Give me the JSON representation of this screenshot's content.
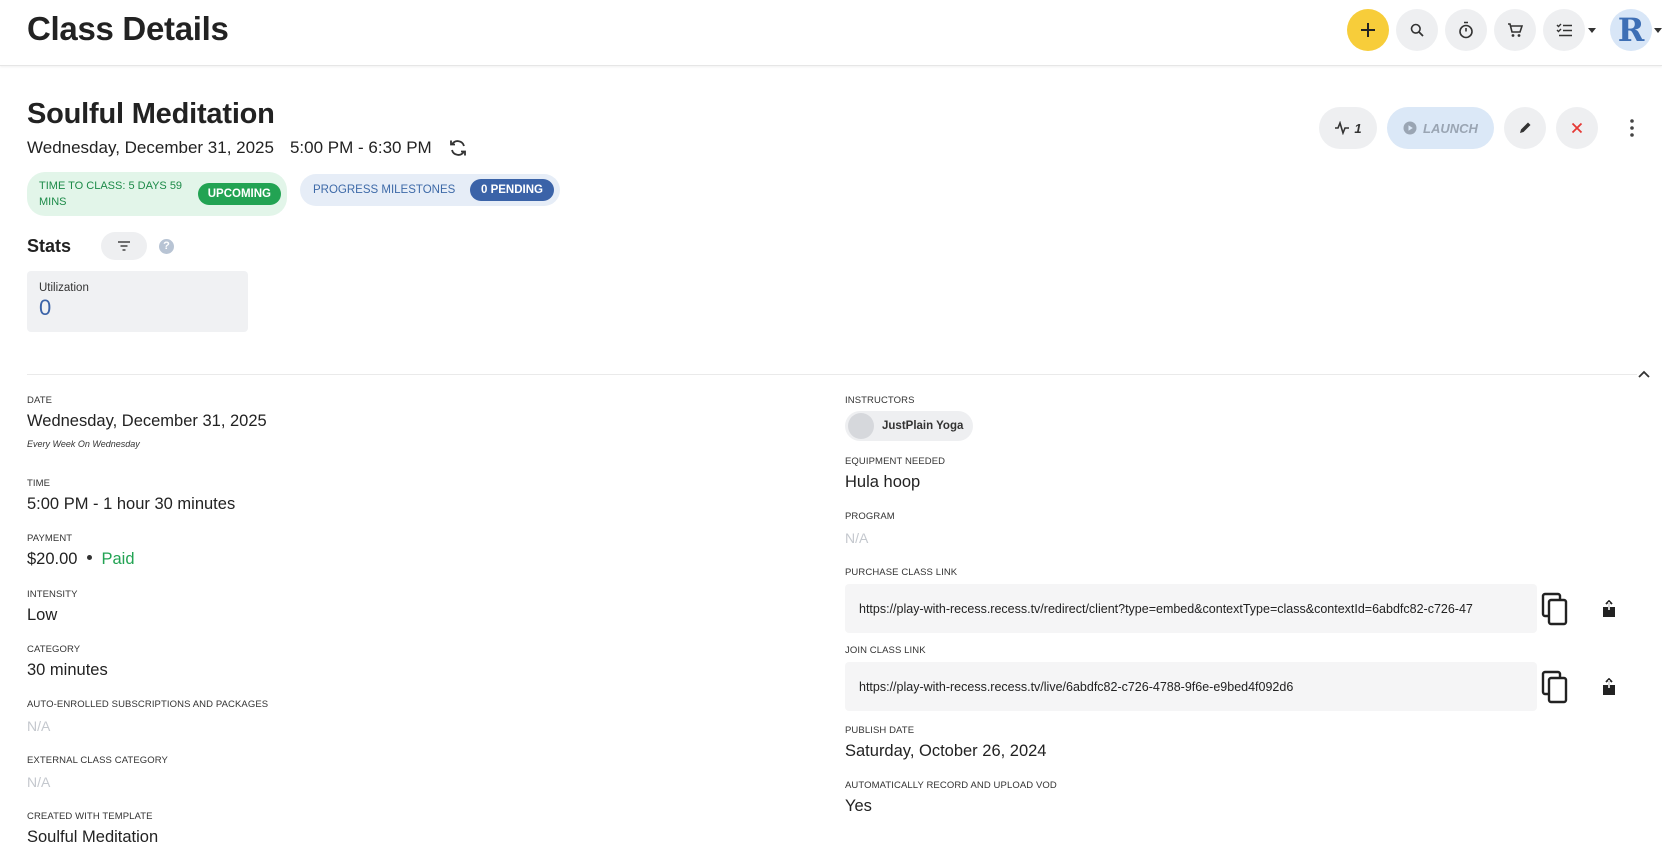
{
  "header": {
    "title": "Class Details",
    "avatar_letter": "R",
    "icons": [
      "plus-icon",
      "search-icon",
      "timer-icon",
      "cart-icon",
      "tasks-icon"
    ]
  },
  "class": {
    "title": "Soulful Meditation",
    "date": "Wednesday, December 31, 2025",
    "time_range": "5:00 PM - 6:30 PM",
    "time_to_class": "TIME TO CLASS: 5 DAYS 59 MINS",
    "status_badge": "UPCOMING",
    "progress_label": "PROGRESS MILESTONES",
    "progress_badge": "0 PENDING"
  },
  "actions": {
    "activity_count": "1",
    "launch_label": "LAUNCH"
  },
  "stats": {
    "title": "Stats",
    "help": "?",
    "utilization_label": "Utilization",
    "utilization_value": "0"
  },
  "details_left": {
    "date_label": "DATE",
    "date_value": "Wednesday, December 31, 2025",
    "recurrence": "Every Week On Wednesday",
    "time_label": "TIME",
    "time_value": "5:00 PM - 1 hour 30 minutes",
    "payment_label": "PAYMENT",
    "payment_amount": "$20.00",
    "payment_status": "Paid",
    "intensity_label": "INTENSITY",
    "intensity_value": "Low",
    "category_label": "CATEGORY",
    "category_value": "30 minutes",
    "auto_enrolled_label": "AUTO-ENROLLED SUBSCRIPTIONS AND PACKAGES",
    "auto_enrolled_value": "N/A",
    "external_category_label": "EXTERNAL CLASS CATEGORY",
    "external_category_value": "N/A",
    "template_label": "CREATED WITH TEMPLATE",
    "template_value": "Soulful Meditation"
  },
  "details_right": {
    "instructors_label": "INSTRUCTORS",
    "instructor_name": "JustPlain Yoga",
    "equipment_label": "EQUIPMENT NEEDED",
    "equipment_value": "Hula hoop",
    "program_label": "PROGRAM",
    "program_value": "N/A",
    "purchase_link_label": "PURCHASE CLASS LINK",
    "purchase_link": "https://play-with-recess.recess.tv/redirect/client?type=embed&contextType=class&contextId=6abdfc82-c726-47",
    "join_link_label": "JOIN CLASS LINK",
    "join_link": "https://play-with-recess.recess.tv/live/6abdfc82-c726-4788-9f6e-e9bed4f092d6",
    "publish_label": "PUBLISH DATE",
    "publish_value": "Saturday, October 26, 2024",
    "auto_record_label": "AUTOMATICALLY RECORD AND UPLOAD VOD",
    "auto_record_value": "Yes"
  },
  "colors": {
    "accent_yellow": "#f7cd3a",
    "green": "#22a353",
    "blue": "#3b63a8",
    "close_red": "#e53935"
  }
}
